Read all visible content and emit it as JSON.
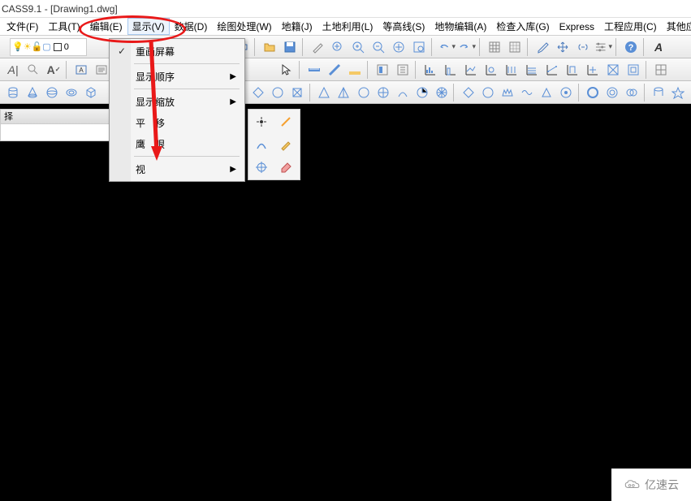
{
  "title": "CASS9.1 - [Drawing1.dwg]",
  "menu": {
    "file": "文件(F)",
    "tools": "工具(T)",
    "edit": "编辑(E)",
    "display": "显示(V)",
    "data": "数据(D)",
    "draw_process": "绘图处理(W)",
    "cadastre": "地籍(J)",
    "land_use": "土地利用(L)",
    "contour": "等高线(S)",
    "terrain_edit": "地物编辑(A)",
    "check_storage": "检查入库(G)",
    "express": "Express",
    "engineering": "工程应用(C)",
    "other": "其他应"
  },
  "dropdown": {
    "redraw": "重画屏幕",
    "display_order": "显示顺序",
    "display_zoom": "显示缩放",
    "pan": "平　移",
    "eagle_eye": "鹰　眼",
    "view": "视　"
  },
  "layer": {
    "value": "0"
  },
  "left_panel": {
    "header": "择"
  },
  "watermark": {
    "text": "亿速云"
  },
  "annotation": {
    "ellipse_color": "#e91919"
  }
}
